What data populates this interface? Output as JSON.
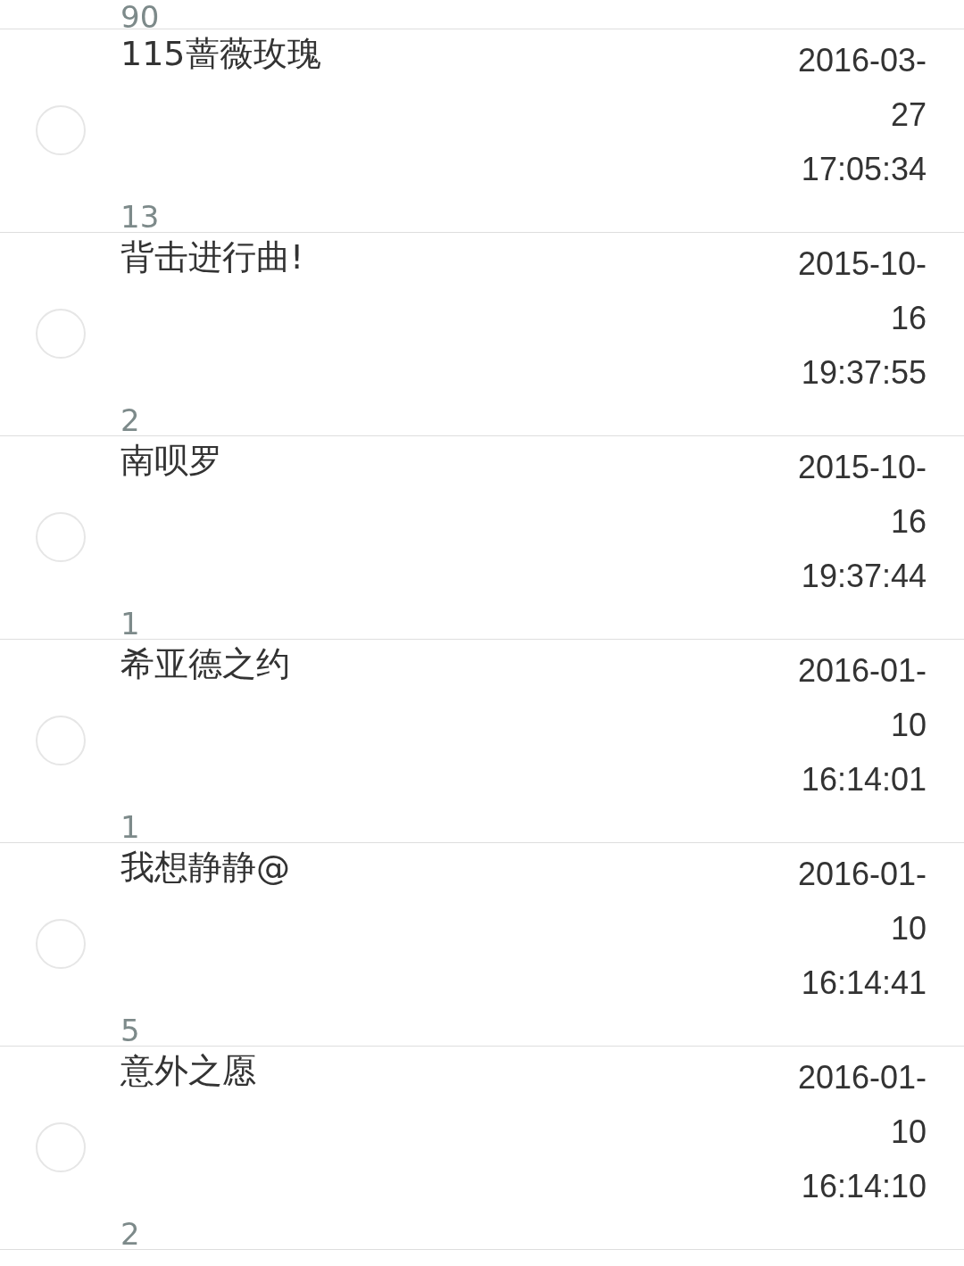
{
  "top_partial_count": "90",
  "rows": [
    {
      "title": "115蔷薇玫瑰",
      "date": "2016-03-27 17:05:34",
      "count": "13",
      "selected": false
    },
    {
      "title": "背击进行曲!",
      "date": "2015-10-16 19:37:55",
      "count": "2",
      "selected": false
    },
    {
      "title": "南呗罗",
      "date": "2015-10-16 19:37:44",
      "count": "1",
      "selected": false
    },
    {
      "title": "希亚德之约",
      "date": "2016-01-10 16:14:01",
      "count": "1",
      "selected": false
    },
    {
      "title": "我想静静@",
      "date": "2016-01-10 16:14:41",
      "count": "5",
      "selected": false
    },
    {
      "title": "意外之愿",
      "date": "2016-01-10 16:14:10",
      "count": "2",
      "selected": false
    }
  ]
}
